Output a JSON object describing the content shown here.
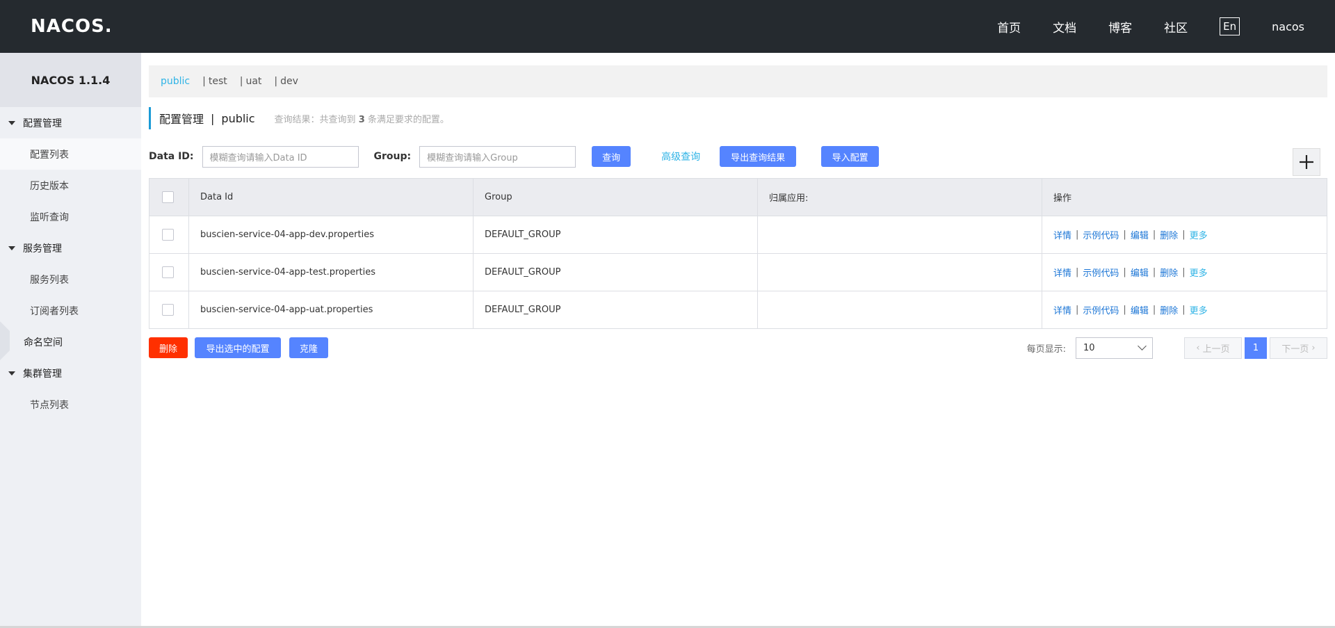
{
  "header": {
    "logo": "NACOS.",
    "nav": [
      "首页",
      "文档",
      "博客",
      "社区"
    ],
    "lang": "En",
    "user": "nacos"
  },
  "sidebar": {
    "version": "NACOS 1.1.4",
    "groups": [
      {
        "label": "配置管理",
        "items": [
          "配置列表",
          "历史版本",
          "监听查询"
        ]
      },
      {
        "label": "服务管理",
        "items": [
          "服务列表",
          "订阅者列表"
        ]
      },
      {
        "label": "命名空间",
        "items": []
      },
      {
        "label": "集群管理",
        "items": [
          "节点列表"
        ]
      }
    ]
  },
  "namespaces": {
    "items": [
      "public",
      "test",
      "uat",
      "dev"
    ],
    "active": "public"
  },
  "title": {
    "main": "配置管理",
    "sep": "|",
    "ns": "public",
    "hint_prefix": "查询结果：共查询到",
    "count": "3",
    "hint_suffix": "条满足要求的配置。"
  },
  "search": {
    "dataid_label": "Data ID:",
    "dataid_placeholder": "模糊查询请输入Data ID",
    "group_label": "Group:",
    "group_placeholder": "模糊查询请输入Group",
    "query_btn": "查询",
    "advanced": "高级查询",
    "export_btn": "导出查询结果",
    "import_btn": "导入配置"
  },
  "table": {
    "headers": [
      "Data Id",
      "Group",
      "归属应用:",
      "操作"
    ],
    "rows": [
      {
        "dataId": "buscien-service-04-app-dev.properties",
        "group": "DEFAULT_GROUP",
        "app": ""
      },
      {
        "dataId": "buscien-service-04-app-test.properties",
        "group": "DEFAULT_GROUP",
        "app": ""
      },
      {
        "dataId": "buscien-service-04-app-uat.properties",
        "group": "DEFAULT_GROUP",
        "app": ""
      }
    ],
    "ops": [
      "详情",
      "示例代码",
      "编辑",
      "删除",
      "更多"
    ]
  },
  "footer": {
    "delete_btn": "删除",
    "export_selected_btn": "导出选中的配置",
    "clone_btn": "克隆",
    "per_page_label": "每页显示:",
    "per_page_value": "10",
    "prev": "上一页",
    "current_page": "1",
    "next": "下一页"
  },
  "colors": {
    "header_bg": "#252a2f",
    "primary": "#5584ff",
    "danger": "#ff3000",
    "link": "#2eb3e6"
  }
}
